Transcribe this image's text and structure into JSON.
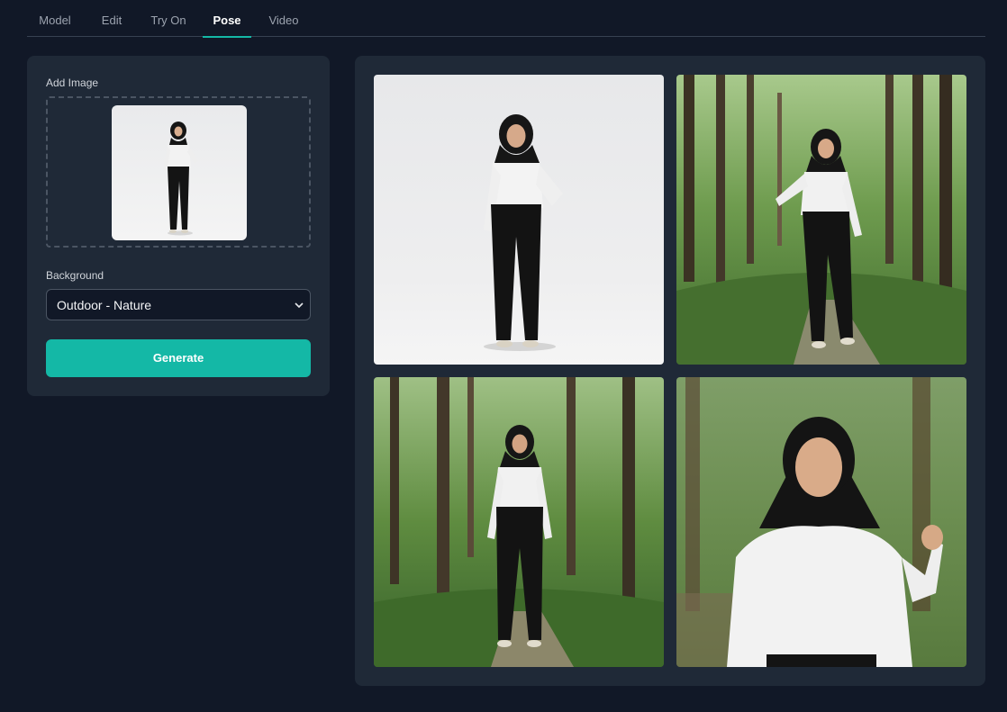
{
  "tabs": [
    {
      "label": "Model",
      "active": false
    },
    {
      "label": "Edit",
      "active": false
    },
    {
      "label": "Try On",
      "active": false
    },
    {
      "label": "Pose",
      "active": true
    },
    {
      "label": "Video",
      "active": false
    }
  ],
  "left_panel": {
    "add_image_label": "Add Image",
    "background_label": "Background",
    "background_selected": "Outdoor - Nature",
    "generate_label": "Generate"
  },
  "results": [
    {
      "background": "studio"
    },
    {
      "background": "forest-path"
    },
    {
      "background": "forest-path"
    },
    {
      "background": "forest-close-up"
    }
  ],
  "icons": {
    "select_chevron": "chevron-down-icon"
  },
  "colors": {
    "page_bg": "#111827",
    "panel_bg": "#1f2937",
    "accent": "#14b8a6",
    "tab_text": "#9ca3af",
    "tab_active_text": "#ffffff"
  }
}
